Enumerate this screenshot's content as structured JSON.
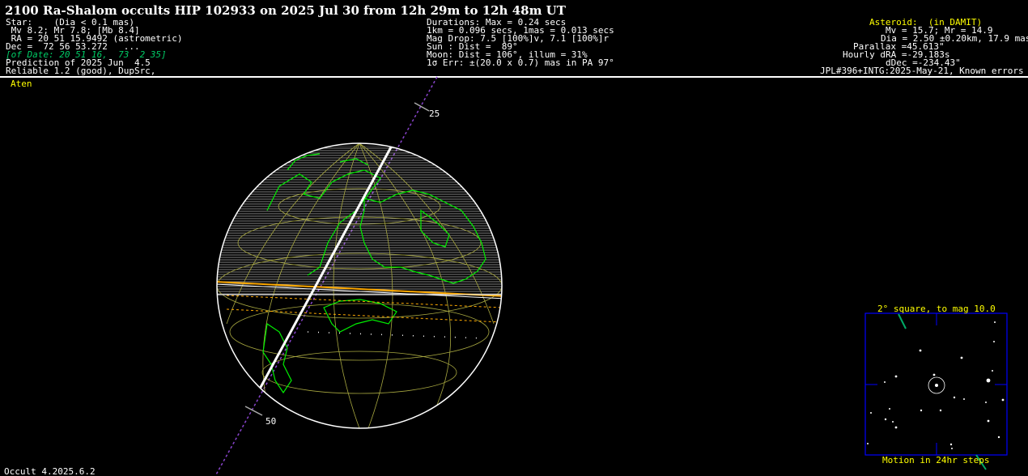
{
  "title": "2100 Ra-Shalom occults HIP 102933 on 2025 Jul 30 from 12h 29m to 12h 48m UT",
  "star": {
    "l1": "Star:    (Dia < 0.1 mas)",
    "l2": " Mv 8.2; Mr 7.8; [Mb 8.4]",
    "l3": " RA = 20 51 15.9492 (astrometric)",
    "l4": "Dec =  72 56 53.272   ...",
    "l5": "[of Date: 20 51 16,  73  2 35]",
    "l6": "Prediction of 2025 Jun  4.5",
    "l7": "Reliable 1.2 (good), DupSrc,"
  },
  "event": {
    "l1": "Durations: Max = 0.24 secs",
    "l2": "1km = 0.096 secs, 1mas = 0.013 secs",
    "l3": "Mag Drop: 7.5 [100%]v, 7.1 [100%]r",
    "l4": "Sun : Dist =  89°",
    "l5": "Moon: Dist = 106°, illum = 31%",
    "l6": "1σ Err: ±(20.0 x 0.7) mas in PA 97°"
  },
  "asteroid": {
    "l1": "Asteroid:  (in DAMIT)",
    "l2": "Mv = 15.7; Mr = 14.9",
    "l3": "Dia = 2.50 ±0.20km, 17.9 mas",
    "l4": "Parallax =45.613\"",
    "l5": "Hourly dRA =-29.183s",
    "l6": "dDec =-234.43\"",
    "l7": "JPL#396+INTG:2025-May-21, Known errors"
  },
  "family": "Aten",
  "path_tick_labels": [
    "25",
    "50"
  ],
  "inset": {
    "top_label": "2° square, to mag 10.0",
    "bottom_label": "Motion in 24hr steps"
  },
  "version": "Occult 4.2025.6.2",
  "colors": {
    "background": "#000000",
    "text": "#ffffff",
    "highlight": "#ffff00",
    "coastline": "#00ee00",
    "grid": "#a8a840",
    "path_center": "#ffffff",
    "path_limits": "#ffaa00",
    "inset_frame": "#0000ff",
    "track": "#8844cc"
  }
}
